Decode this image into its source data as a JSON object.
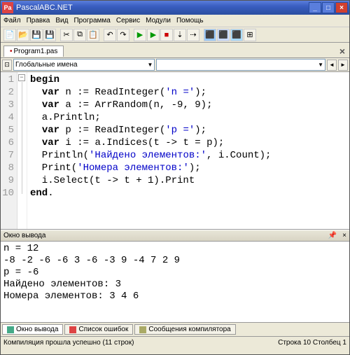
{
  "window": {
    "title": "PascalABC.NET"
  },
  "menu": [
    "Файл",
    "Правка",
    "Вид",
    "Программа",
    "Сервис",
    "Модули",
    "Помощь"
  ],
  "tab": {
    "name": "Program1.pas",
    "dirty": "•"
  },
  "nav": {
    "label": "Глобальные имена"
  },
  "code": {
    "lines": [
      {
        "n": "1",
        "indent": "",
        "kw": "begin",
        "rest": ""
      },
      {
        "n": "2",
        "indent": "  ",
        "kw": "var",
        "rest": " n := ReadInteger(",
        "str": "'n ='",
        "tail": ");"
      },
      {
        "n": "3",
        "indent": "  ",
        "kw": "var",
        "rest": " a := ArrRandom(n, -9, 9);"
      },
      {
        "n": "4",
        "indent": "  ",
        "rest": "a.Println;"
      },
      {
        "n": "5",
        "indent": "  ",
        "kw": "var",
        "rest": " p := ReadInteger(",
        "str": "'p ='",
        "tail": ");"
      },
      {
        "n": "6",
        "indent": "  ",
        "kw": "var",
        "rest": " i := a.Indices(t -> t = p);"
      },
      {
        "n": "7",
        "indent": "  ",
        "rest": "Println(",
        "str": "'Найдено элементов:'",
        "tail": ", i.Count);"
      },
      {
        "n": "8",
        "indent": "  ",
        "rest": "Print(",
        "str": "'Номера элементов:'",
        "tail": ");"
      },
      {
        "n": "9",
        "indent": "  ",
        "rest": "i.Select(t -> t + 1).Print"
      },
      {
        "n": "10",
        "indent": "",
        "kw": "end",
        "rest": "."
      }
    ]
  },
  "outputpanel": {
    "title": "Окно вывода"
  },
  "output": "n = 12\n-8 -2 -6 -6 3 -6 -3 9 -4 7 2 9\np = -6\nНайдено элементов: 3\nНомера элементов: 3 4 6",
  "btabs": [
    {
      "label": "Окно вывода"
    },
    {
      "label": "Список ошибок"
    },
    {
      "label": "Сообщения компилятора"
    }
  ],
  "status": {
    "left": "Компиляция прошла успешно (11 строк)",
    "right": "Строка 10  Столбец 1"
  }
}
